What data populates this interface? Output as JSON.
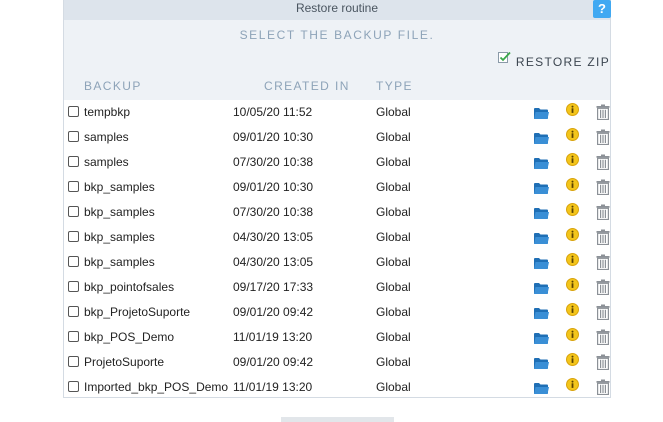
{
  "window": {
    "title": "Restore routine",
    "help_label": "?"
  },
  "header": {
    "instruction": "SELECT THE BACKUP FILE.",
    "restore_zip_label": "RESTORE ZIP"
  },
  "columns": {
    "backup": "BACKUP",
    "created_in": "CREATED IN",
    "type": "TYPE"
  },
  "icons": {
    "open": "folder-icon",
    "info": "info-icon",
    "delete": "trash-icon",
    "restore_zip": "checkmark-document-icon"
  },
  "colors": {
    "title_bar": "#dde4ec",
    "subheader": "#eef2f6",
    "help_button": "#41a9f2",
    "column_header_text": "#8da3b8",
    "folder_icon": "#1f6fb5",
    "info_icon": "#f3c51b",
    "trash_icon": "#8c9197"
  },
  "backups": [
    {
      "name": "tempbkp",
      "created": "10/05/20 11:52",
      "type": "Global"
    },
    {
      "name": "samples",
      "created": "09/01/20 10:30",
      "type": "Global"
    },
    {
      "name": "samples",
      "created": "07/30/20 10:38",
      "type": "Global"
    },
    {
      "name": "bkp_samples",
      "created": "09/01/20 10:30",
      "type": "Global"
    },
    {
      "name": "bkp_samples",
      "created": "07/30/20 10:38",
      "type": "Global"
    },
    {
      "name": "bkp_samples",
      "created": "04/30/20 13:05",
      "type": "Global"
    },
    {
      "name": "bkp_samples",
      "created": "04/30/20 13:05",
      "type": "Global"
    },
    {
      "name": "bkp_pointofsales",
      "created": "09/17/20 17:33",
      "type": "Global"
    },
    {
      "name": "bkp_ProjetoSuporte",
      "created": "09/01/20 09:42",
      "type": "Global"
    },
    {
      "name": "bkp_POS_Demo",
      "created": "11/01/19 13:20",
      "type": "Global"
    },
    {
      "name": "ProjetoSuporte",
      "created": "09/01/20 09:42",
      "type": "Global"
    },
    {
      "name": "Imported_bkp_POS_Demo",
      "created": "11/01/19 13:20",
      "type": "Global"
    }
  ]
}
